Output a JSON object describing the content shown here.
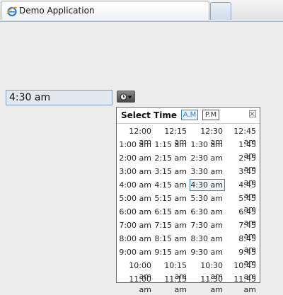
{
  "browser": {
    "tab_title": "Demo Application"
  },
  "time_field": {
    "value": "4:30 am"
  },
  "picker": {
    "title": "Select Time",
    "am_label": "A.M",
    "pm_label": "P.M",
    "selected": "4:30 am",
    "rows": [
      [
        "12:00 am",
        "12:15 am",
        "12:30 am",
        "12:45 am"
      ],
      [
        "1:00 am",
        "1:15 am",
        "1:30 am",
        "1:45 am"
      ],
      [
        "2:00 am",
        "2:15 am",
        "2:30 am",
        "2:45 am"
      ],
      [
        "3:00 am",
        "3:15 am",
        "3:30 am",
        "3:45 am"
      ],
      [
        "4:00 am",
        "4:15 am",
        "4:30 am",
        "4:45 am"
      ],
      [
        "5:00 am",
        "5:15 am",
        "5:30 am",
        "5:45 am"
      ],
      [
        "6:00 am",
        "6:15 am",
        "6:30 am",
        "6:45 am"
      ],
      [
        "7:00 am",
        "7:15 am",
        "7:30 am",
        "7:45 am"
      ],
      [
        "8:00 am",
        "8:15 am",
        "8:30 am",
        "8:45 am"
      ],
      [
        "9:00 am",
        "9:15 am",
        "9:30 am",
        "9:45 am"
      ],
      [
        "10:00 am",
        "10:15 am",
        "10:30 am",
        "10:45 am"
      ],
      [
        "11:00 am",
        "11:15 am",
        "11:30 am",
        "11:45 am"
      ]
    ]
  },
  "colors": {
    "accent": "#2f7fcf",
    "input_bg": "#e3e7ee"
  },
  "icons": {
    "tab_icon": "ie-browser-icon",
    "picker_button": "clock-dropdown-icon",
    "close": "close-icon"
  }
}
